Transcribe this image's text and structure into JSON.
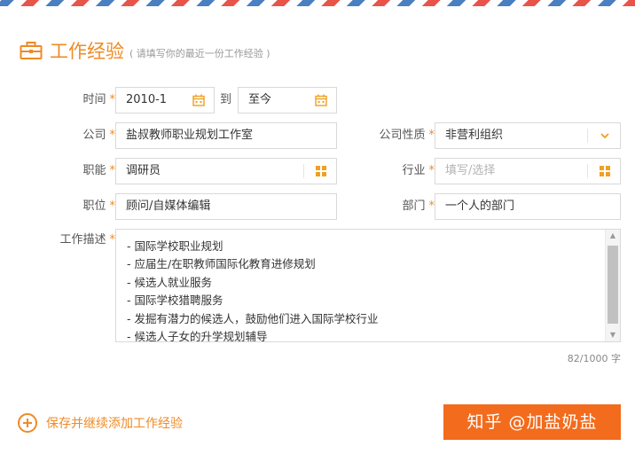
{
  "header": {
    "title": "工作经验",
    "subtitle": "( 请填写你的最近一份工作经验 )",
    "icon": "briefcase-icon",
    "accent": "#f08a24"
  },
  "form": {
    "time": {
      "label": "时间",
      "start_value": "2010-1",
      "separator": "到",
      "end_value": "至今"
    },
    "company": {
      "label": "公司",
      "value": "盐叔教师职业规划工作室"
    },
    "company_type": {
      "label": "公司性质",
      "value": "非营利组织"
    },
    "function": {
      "label": "职能",
      "value": "调研员"
    },
    "industry": {
      "label": "行业",
      "placeholder": "填写/选择"
    },
    "position": {
      "label": "职位",
      "value": "顾问/自媒体编辑"
    },
    "department": {
      "label": "部门",
      "value": "一个人的部门"
    },
    "description": {
      "label": "工作描述",
      "lines": [
        "- 国际学校职业规划",
        "- 应届生/在职教师国际化教育进修规划",
        "- 候选人就业服务",
        "- 国际学校猎聘服务",
        "- 发掘有潜力的候选人，鼓励他们进入国际学校行业",
        "- 候选人子女的升学规划辅导"
      ],
      "counter": "82/1000 字"
    },
    "required_mark": "*"
  },
  "footer": {
    "add_link": "保存并继续添加工作经验",
    "watermark": "知乎 @加盐奶盐",
    "button_color": "#f36b1c"
  }
}
